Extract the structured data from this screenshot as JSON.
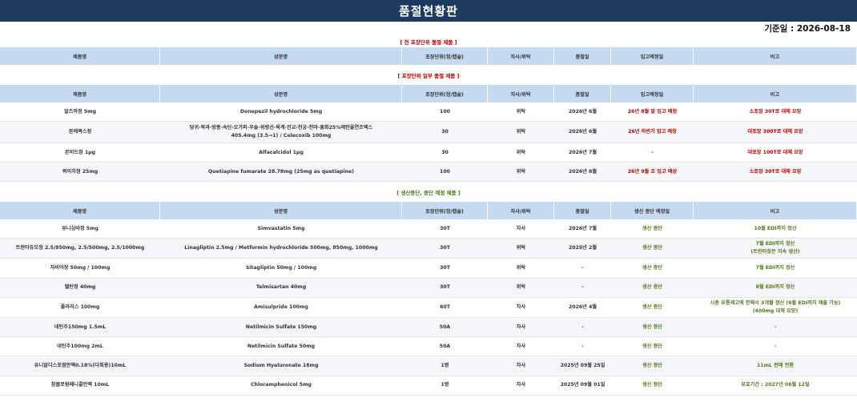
{
  "header": {
    "title": "품절현황판",
    "date_label": "기준일 : 2026-08-18"
  },
  "section1": {
    "label": "[ 전 포장단위 품절 제품 ]",
    "columns": [
      "제품명",
      "성분명",
      "포장단위(정/캡슐)",
      "자사/위탁",
      "품절일",
      "입고예정일",
      "비고"
    ]
  },
  "section2": {
    "label": "[ 포장단위 일부 품절 제품 ]",
    "columns": [
      "제품명",
      "성분명",
      "포장단위(정/캡슐)",
      "자사/위탁",
      "품절일",
      "입고예정일",
      "비고"
    ],
    "rows": [
      {
        "name": "알츠하정 5mg",
        "ingredient": "Donepezil hydrochloride 5mg",
        "unit": "100",
        "type": "위탁",
        "soldout": "2026년 6월",
        "eta": "26년 8월 말 입고 예정",
        "note": "소포장 30T로 대체 요망"
      },
      {
        "name": "본에콕스정",
        "ingredient": "당귀·목과·방풍·속단·오가피·우슬·위령선·육계·진교·천궁·천마·홍화25%에탄올연조엑스\n405.4mg (3.5→1) /  Celecoxib 100mg",
        "unit": "30",
        "type": "위탁",
        "soldout": "2026년 6월",
        "eta": "26년 하반기 입고 예정",
        "note": "대포장 300T로 대체 요망"
      },
      {
        "name": "본비드정 1μg",
        "ingredient": "Alfacalcidol 1μg",
        "unit": "30",
        "type": "위탁",
        "soldout": "2026년 7월",
        "eta": "-",
        "note": "대포장 100T로 대체 요망"
      },
      {
        "name": "쿼이치정 25mg",
        "ingredient": "Quetiapine fumarate 28.78mg (25mg as quetiapine)",
        "unit": "100",
        "type": "위탁",
        "soldout": "2026년 8월",
        "eta": "26년 9월 초 입고 예상",
        "note": "소포장 30T로 대체 요망"
      }
    ]
  },
  "section3": {
    "label": "[ 생산중단, 중단 예정 제품 ]",
    "columns": [
      "제품명",
      "성분명",
      "포장단위(정/캡슐)",
      "자사/위탁",
      "품절일",
      "생산 중단 예정일",
      "비고"
    ],
    "rows": [
      {
        "name": "유니심바정 5mg",
        "ingredient": "Simvastatin 5mg",
        "unit": "30T",
        "type": "자사",
        "soldout": "2026년 7월",
        "eta": "생산 중단",
        "note": "10월 EDI까지 정산"
      },
      {
        "name": "트란타듀오정 2.5/850mg, 2.5/500mg, 2.5/1000mg",
        "ingredient": "Linagliptin 2.5mg / Metformin hydrochloride 500mg, 850mg, 1000mg",
        "unit": "30T",
        "type": "위탁",
        "soldout": "2025년 2월",
        "eta": "생산 중단",
        "note": "7월 EDI까지 정산\n(트란타정은 지속 생산)"
      },
      {
        "name": "자비아정 50mg / 100mg",
        "ingredient": "Sitagliptin 50mg / 100mg",
        "unit": "30T",
        "type": "위탁",
        "soldout": "-",
        "eta": "생산 중단",
        "note": "7월 EDI까지 정산"
      },
      {
        "name": "텔탄정 40mg",
        "ingredient": "Telmisartan 40mg",
        "unit": "30T",
        "type": "위탁",
        "soldout": "-",
        "eta": "생산 중단",
        "note": "8월 EDI까지 정산"
      },
      {
        "name": "폴라리스 100mg",
        "ingredient": "Amisulpride 100mg",
        "unit": "60T",
        "type": "자사",
        "soldout": "2026년 4월",
        "eta": "생산 중단",
        "note": "시중 유통재고에 한해서 3개월 정산 (6월 EDI까지 제출 가능)\n(400mg 대체 요망)"
      },
      {
        "name": "네틴주150mg 1.5mL",
        "ingredient": "Netilmicin Sulfate 150mg",
        "unit": "50A",
        "type": "자사",
        "soldout": "-",
        "eta": "생산 중단",
        "note": "-"
      },
      {
        "name": "네틴주100mg 2mL",
        "ingredient": "Netilmicin Sulfate 50mg",
        "unit": "50A",
        "type": "자사",
        "soldout": "-",
        "eta": "생산 중단",
        "note": "-"
      },
      {
        "name": "유니알디스포점안액0.18%(다회용)10mL",
        "ingredient": "Sodium Hyaluronate 18mg",
        "unit": "1병",
        "type": "자사",
        "soldout": "2025년 09월 25일",
        "eta": "생산 중단",
        "note": "11mL 판매 전환"
      },
      {
        "name": "참클로람페니콜안액 10mL",
        "ingredient": "Chloramphenicol 5mg",
        "unit": "1병",
        "type": "자사",
        "soldout": "2025년 09월 01일",
        "eta": "생산 중단",
        "note": "유효기간 : 2027년 06월 12일"
      }
    ]
  }
}
